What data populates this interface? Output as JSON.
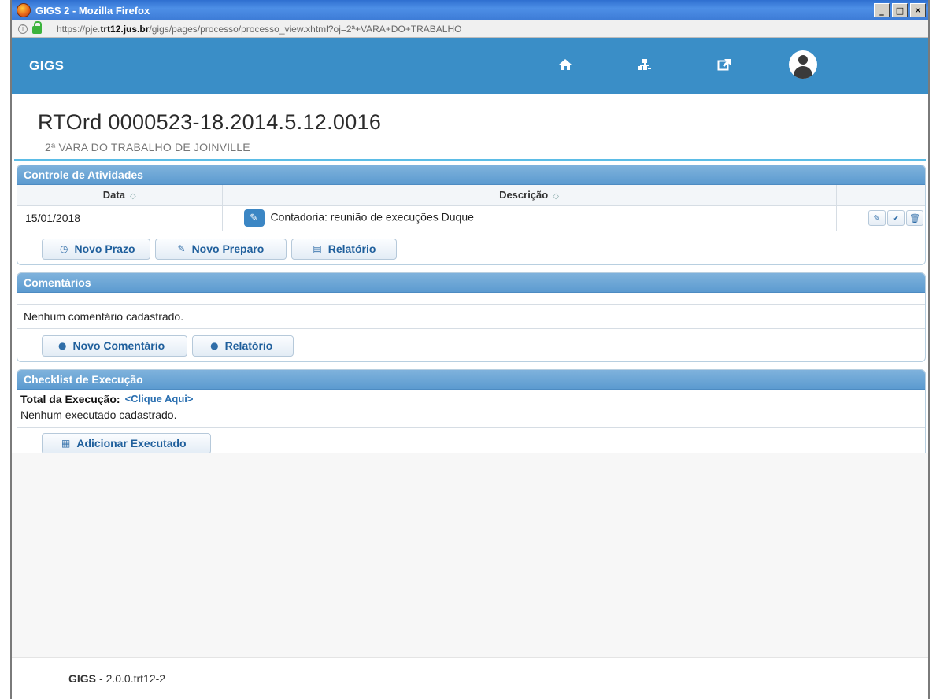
{
  "window": {
    "title": "GIGS 2 - Mozilla Firefox",
    "url_prefix": "https://pje.",
    "url_host": "trt12.jus.br",
    "url_rest": "/gigs/pages/processo/processo_view.xhtml?oj=2ª+VARA+DO+TRABALHO"
  },
  "navbar": {
    "brand": "GIGS",
    "icons": [
      "home-icon",
      "sitemap-icon",
      "external-link-icon",
      "user-avatar-icon"
    ]
  },
  "header": {
    "title": "RTOrd 0000523-18.2014.5.12.0016",
    "subtitle": "2ª VARA DO TRABALHO DE JOINVILLE"
  },
  "atividades": {
    "title": "Controle de Atividades",
    "columns": [
      "Data",
      "Descrição"
    ],
    "rows": [
      {
        "date": "15/01/2018",
        "description": "Contadoria: reunião de execuções Duque"
      }
    ],
    "buttons": {
      "novo_prazo": "Novo Prazo",
      "novo_preparo": "Novo Preparo",
      "relatorio": "Relatório"
    }
  },
  "comentarios": {
    "title": "Comentários",
    "empty": "Nenhum comentário cadastrado.",
    "buttons": {
      "novo_comentario": "Novo Comentário",
      "relatorio": "Relatório"
    }
  },
  "checklist": {
    "title": "Checklist de Execução",
    "total_label": "Total da Execução:",
    "total_link": "<Clique Aqui>",
    "empty": "Nenhum executado cadastrado.",
    "buttons": {
      "adicionar": "Adicionar Executado"
    }
  },
  "footer": {
    "brand": "GIGS",
    "version": "- 2.0.0.trt12-2"
  }
}
